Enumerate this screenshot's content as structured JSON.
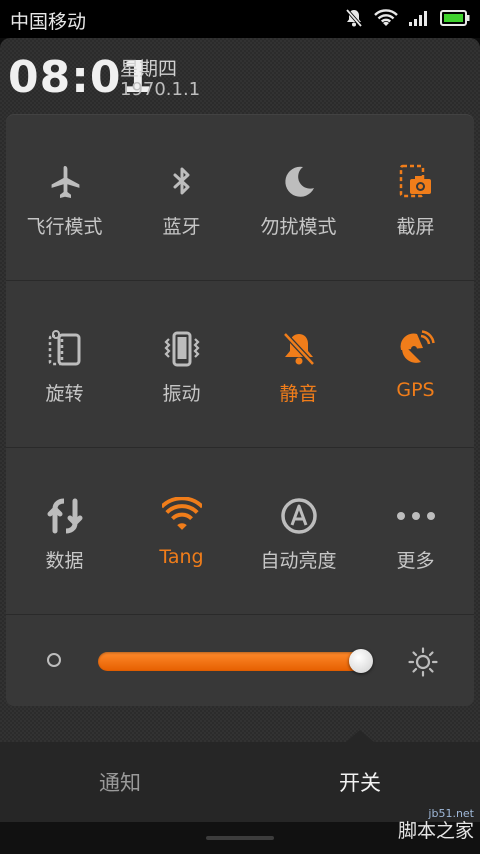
{
  "status_bar": {
    "carrier": "中国移动"
  },
  "header": {
    "time": "08:01",
    "weekday": "星期四",
    "date": "1970.1.1"
  },
  "toggles": [
    {
      "label": "飞行模式",
      "icon": "airplane-icon",
      "active": false
    },
    {
      "label": "蓝牙",
      "icon": "bluetooth-icon",
      "active": false
    },
    {
      "label": "勿扰模式",
      "icon": "moon-icon",
      "active": false
    },
    {
      "label": "截屏",
      "icon": "screenshot-icon",
      "active": true
    },
    {
      "label": "旋转",
      "icon": "rotate-icon",
      "active": false
    },
    {
      "label": "振动",
      "icon": "vibrate-icon",
      "active": false
    },
    {
      "label": "静音",
      "icon": "mute-icon",
      "active": true
    },
    {
      "label": "GPS",
      "icon": "gps-icon",
      "active": true
    },
    {
      "label": "数据",
      "icon": "data-icon",
      "active": false
    },
    {
      "label": "Tang",
      "icon": "wifi-icon",
      "active": true
    },
    {
      "label": "自动亮度",
      "icon": "auto-brightness-icon",
      "active": false
    },
    {
      "label": "更多",
      "icon": "more-icon",
      "active": false
    }
  ],
  "brightness": {
    "level": 0.99
  },
  "tabs": {
    "left": "通知",
    "right": "开关",
    "selected": "开关"
  },
  "watermark": {
    "site": "jb51.net",
    "name": "脚本之家"
  },
  "colors": {
    "accent": "#f07d1a",
    "inactive_icon": "#bdbdbd",
    "panel": "#383838"
  }
}
